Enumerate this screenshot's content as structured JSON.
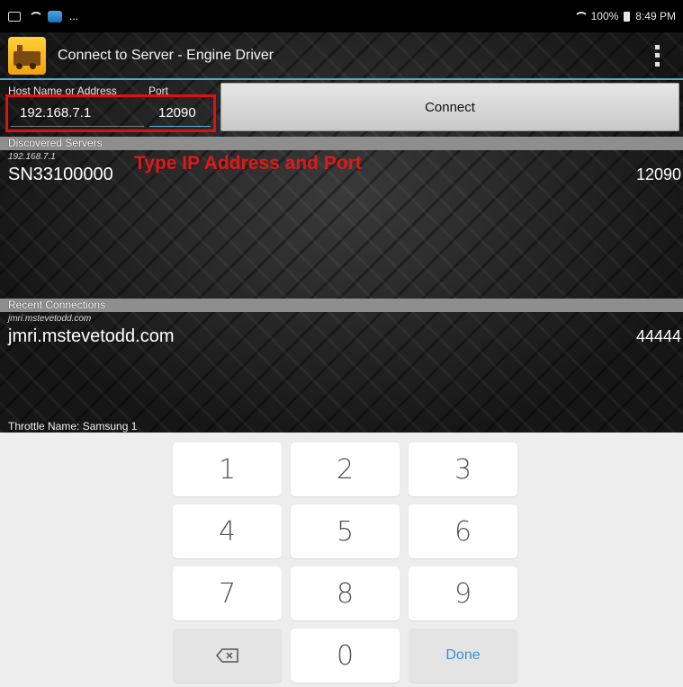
{
  "status_bar": {
    "left_ellipsis": "...",
    "battery": "100%",
    "time": "8:49 PM"
  },
  "action_bar": {
    "title": "Connect to Server - Engine Driver",
    "menu_icon": "overflow-menu-icon"
  },
  "connection": {
    "host_label": "Host Name or Address",
    "port_label": "Port",
    "host_value": "192.168.7.1",
    "port_value": "12090",
    "connect_label": "Connect",
    "annotation": "Type IP Address and Port",
    "annotation_color": "#e01818"
  },
  "discovered": {
    "header": "Discovered Servers",
    "items": [
      {
        "address": "192.168.7.1",
        "name": "SN33100000",
        "port": "12090"
      }
    ]
  },
  "recent": {
    "header": "Recent Connections",
    "items": [
      {
        "address": "jmri.mstevetodd.com",
        "name": "jmri.mstevetodd.com",
        "port": "44444"
      }
    ]
  },
  "throttle_name": "Throttle Name: Samsung 1",
  "keypad": {
    "keys": [
      "1",
      "2",
      "3",
      "4",
      "5",
      "6",
      "7",
      "8",
      "9",
      "0"
    ],
    "backspace_icon": "backspace-icon",
    "done_label": "Done",
    "done_color": "#3a8fd6"
  }
}
